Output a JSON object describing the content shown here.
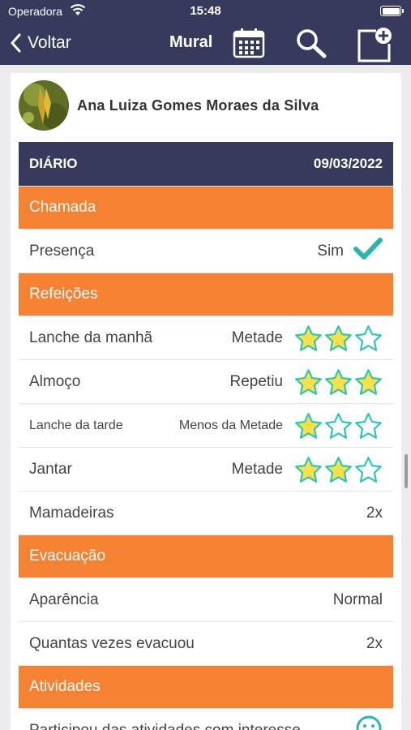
{
  "status_bar": {
    "carrier": "Operadora",
    "time": "15:48"
  },
  "nav": {
    "back_label": "Voltar",
    "title": "Mural"
  },
  "post": {
    "author_name": "Ana Luiza Gomes Moraes da Silva"
  },
  "diary": {
    "header_label": "DIÁRIO",
    "date": "09/03/2022",
    "sections": [
      {
        "title": "Chamada"
      },
      {
        "title": "Refeições"
      },
      {
        "title": "Evacuação"
      },
      {
        "title": "Atividades"
      }
    ],
    "presence": {
      "label": "Presença",
      "value": "Sim"
    },
    "meals": [
      {
        "label": "Lanche da manhã",
        "value": "Metade",
        "stars_filled": 2,
        "stars_total": 3
      },
      {
        "label": "Almoço",
        "value": "Repetiu",
        "stars_filled": 3,
        "stars_total": 3
      },
      {
        "label": "Lanche da tarde",
        "value": "Menos da Metade",
        "stars_filled": 1,
        "stars_total": 3
      },
      {
        "label": "Jantar",
        "value": "Metade",
        "stars_filled": 2,
        "stars_total": 3
      }
    ],
    "bottles": {
      "label": "Mamadeiras",
      "value": "2x"
    },
    "evacuation": [
      {
        "label": "Aparência",
        "value": "Normal"
      },
      {
        "label": "Quantas vezes evacuou",
        "value": "2x"
      }
    ],
    "activities": [
      {
        "label": "Participou das atividades com interesse"
      }
    ]
  },
  "colors": {
    "header": "#373a5c",
    "section": "#f58233",
    "star_fill": "#f7e04a",
    "star_outline": "#2ec4b6",
    "check": "#2ab7a9"
  }
}
